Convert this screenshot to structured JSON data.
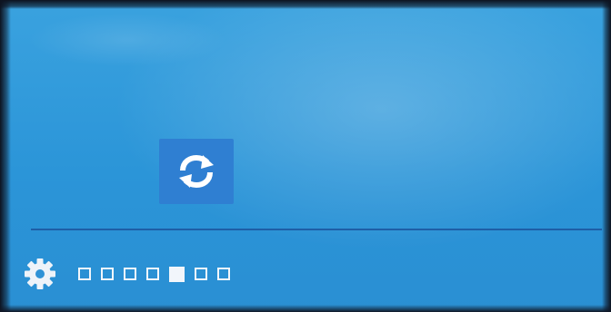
{
  "screen": {
    "accent_background": "#2b95d8",
    "tile_color": "#2f7fd2",
    "divider_color": "#1e5ea6"
  },
  "main": {
    "refresh_tile_icon": "refresh-icon"
  },
  "bottom_bar": {
    "settings_icon": "gear-icon",
    "page_indicator": {
      "total_pages": 7,
      "current_page": 5
    }
  }
}
